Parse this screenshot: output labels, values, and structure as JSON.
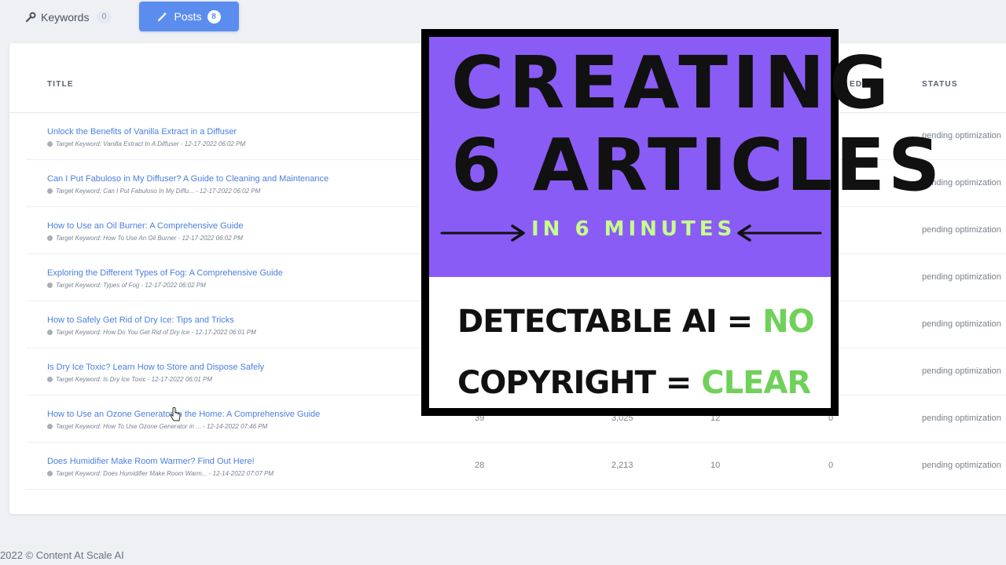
{
  "tabs": {
    "keywords": {
      "label": "Keywords",
      "count": "0"
    },
    "posts": {
      "label": "Posts",
      "count": "8"
    }
  },
  "table": {
    "headers": {
      "title": "TITLE",
      "media": "EDIA",
      "status": "STATUS"
    },
    "rows": [
      {
        "title": "Unlock the Benefits of Vanilla Extract in a Diffuser",
        "meta": "Target Keyword: Vanilla Extract In A Diffuser - 12-17-2022 06:02 PM",
        "c1": "",
        "c2": "",
        "c3": "",
        "c4": "",
        "status": "pending optimization"
      },
      {
        "title": "Can I Put Fabuloso in My Diffuser? A Guide to Cleaning and Maintenance",
        "meta": "Target Keyword: Can I Put Fabuloso In My Diffu... - 12-17-2022 06:02 PM",
        "c1": "",
        "c2": "",
        "c3": "",
        "c4": "",
        "status": "pending optimization"
      },
      {
        "title": "How to Use an Oil Burner: A Comprehensive Guide",
        "meta": "Target Keyword: How To Use An Oil Burner - 12-17-2022 06:02 PM",
        "c1": "",
        "c2": "",
        "c3": "",
        "c4": "",
        "status": "pending optimization"
      },
      {
        "title": "Exploring the Different Types of Fog: A Comprehensive Guide",
        "meta": "Target Keyword: Types of Fog - 12-17-2022 06:02 PM",
        "c1": "",
        "c2": "",
        "c3": "",
        "c4": "",
        "status": "pending optimization"
      },
      {
        "title": "How to Safely Get Rid of Dry Ice: Tips and Tricks",
        "meta": "Target Keyword: How Do You Get Rid of Dry Ice - 12-17-2022 06:01 PM",
        "c1": "",
        "c2": "",
        "c3": "",
        "c4": "",
        "status": "pending optimization"
      },
      {
        "title": "Is Dry Ice Toxic? Learn How to Store and Dispose Safely",
        "meta": "Target Keyword: Is Dry Ice Toxic - 12-17-2022 06:01 PM",
        "c1": "",
        "c2": "",
        "c3": "",
        "c4": "",
        "status": "pending optimization"
      },
      {
        "title": "How to Use an Ozone Generator in the Home: A Comprehensive Guide",
        "meta": "Target Keyword: How To Use Ozone Generator in ... - 12-14-2022 07:46 PM",
        "c1": "39",
        "c2": "3,025",
        "c3": "12",
        "c4": "0",
        "status": "pending optimization"
      },
      {
        "title": "Does Humidifier Make Room Warmer? Find Out Here!",
        "meta": "Target Keyword: Does Humidifier Make Room Warm... - 12-14-2022 07:07 PM",
        "c1": "28",
        "c2": "2,213",
        "c3": "10",
        "c4": "0",
        "status": "pending optimization"
      }
    ]
  },
  "footer": {
    "text": "2022 © Content At Scale AI"
  },
  "overlay": {
    "line1": "CREATING",
    "line2": "6 ARTICLES",
    "subtitle": "IN 6 MINUTES",
    "eq1_label": "DETECTABLE AI = ",
    "eq1_value": "NO",
    "eq2_label": "COPYRIGHT = ",
    "eq2_value": "CLEAR",
    "colors": {
      "purple": "#8a5cf6",
      "green": "#6fd15a",
      "sub_green": "#c8ff8a"
    }
  },
  "icons": {
    "keywords": "wrench-icon",
    "posts": "magic-wand-icon",
    "cursor": "hand-pointer-icon"
  }
}
